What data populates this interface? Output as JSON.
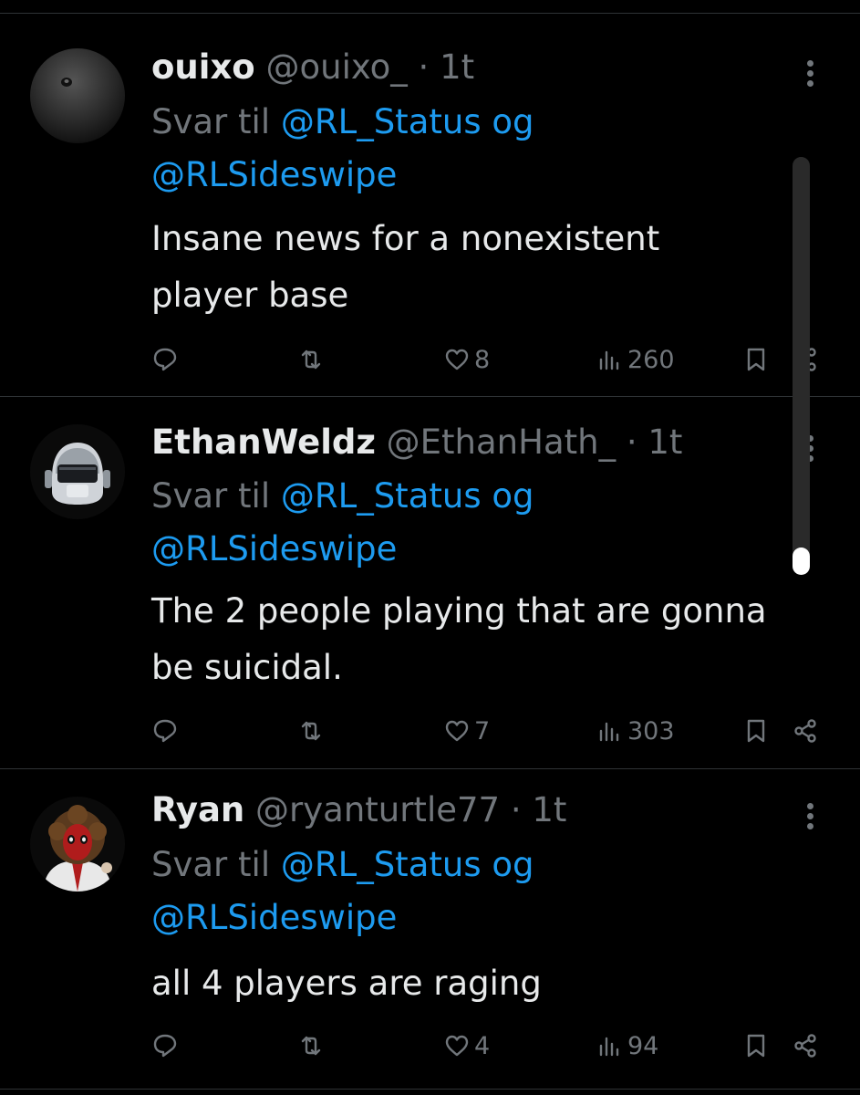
{
  "tweets": [
    {
      "name": "ouixo",
      "handle": "@ouixo_",
      "dot": "·",
      "time": "1t",
      "reply_prefix": "Svar til",
      "mention1": "@RL_Status",
      "reply_joiner": "og",
      "mention2": "@RLSideswipe",
      "body_lines": [
        "Insane news for a nonexistent",
        "player base"
      ],
      "replies": "",
      "reposts": "",
      "likes": "8",
      "views": "260",
      "avatar_icon": "dark-orb-avatar"
    },
    {
      "name": "EthanWeldz",
      "handle": "@EthanHath_",
      "dot": "·",
      "time": "1t",
      "reply_prefix": "Svar til",
      "mention1": "@RL_Status",
      "reply_joiner": "og",
      "mention2": "@RLSideswipe",
      "body_lines": [
        "The 2 people playing that are gonna",
        "be suicidal."
      ],
      "replies": "",
      "reposts": "",
      "likes": "7",
      "views": "303",
      "avatar_icon": "robot-helmet-avatar"
    },
    {
      "name": "Ryan",
      "handle": "@ryanturtle77",
      "dot": "·",
      "time": "1t",
      "reply_prefix": "Svar til",
      "mention1": "@RL_Status",
      "reply_joiner": "og",
      "mention2": "@RLSideswipe",
      "body_lines": [
        "all 4 players are raging"
      ],
      "replies": "",
      "reposts": "",
      "likes": "4",
      "views": "94",
      "avatar_icon": "costumed-character-avatar"
    }
  ],
  "colors": {
    "background": "#000000",
    "text": "#e7e9ea",
    "muted": "#71767b",
    "accent": "#1d9bf0",
    "separator": "#2f3336"
  },
  "icons": {
    "reply": "reply-icon",
    "repost": "repost-icon",
    "like": "heart-icon",
    "views": "views-icon",
    "bookmark": "bookmark-icon",
    "share": "share-icon",
    "more": "more-icon"
  },
  "scrollbar": {
    "position": 0.95
  }
}
